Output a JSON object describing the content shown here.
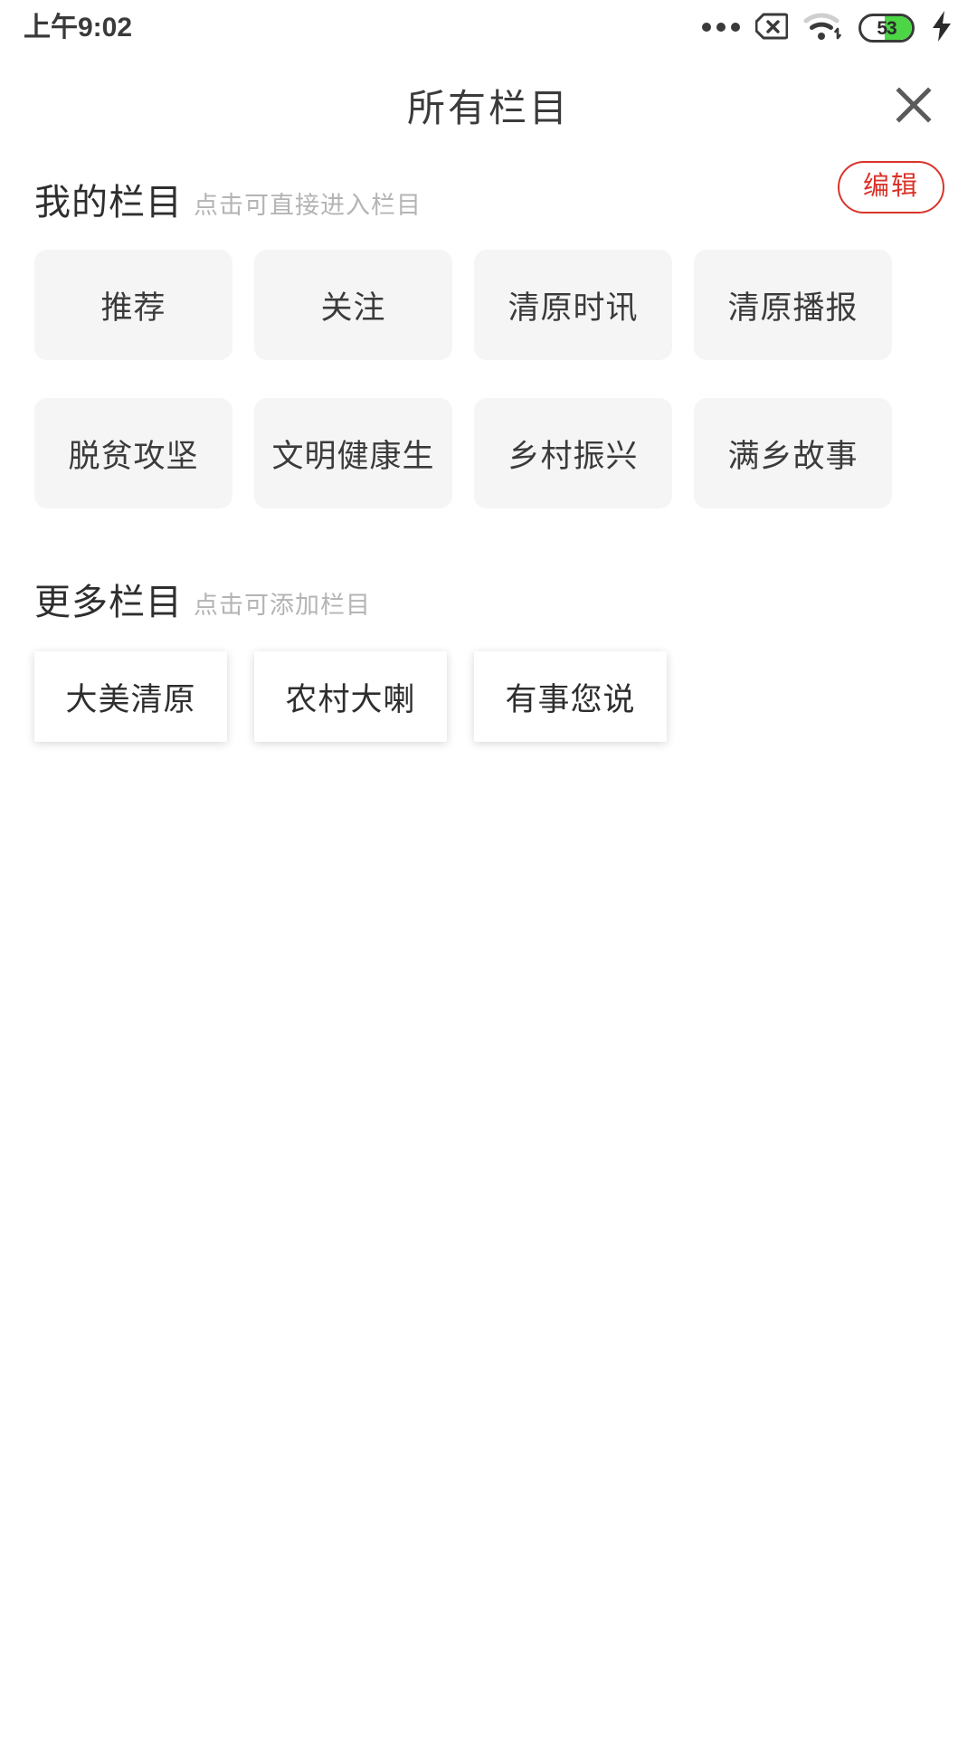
{
  "status_bar": {
    "time": "上午9:02",
    "battery_percent": "53",
    "battery_level": 53,
    "icons": [
      "more-dots-icon",
      "sim-card-disabled-icon",
      "wifi-icon",
      "battery-icon",
      "charging-bolt-icon"
    ]
  },
  "header": {
    "title": "所有栏目",
    "close_label": "×"
  },
  "my_columns": {
    "title": "我的栏目",
    "subtitle": "点击可直接进入栏目",
    "edit_label": "编辑",
    "edit_color": "#d9342b",
    "tile_bg": "#f5f5f5",
    "items": [
      {
        "label": "推荐"
      },
      {
        "label": "关注"
      },
      {
        "label": "清原时讯"
      },
      {
        "label": "清原播报"
      },
      {
        "label": "脱贫攻坚"
      },
      {
        "label": "文明健康生"
      },
      {
        "label": "乡村振兴"
      },
      {
        "label": "满乡故事"
      }
    ]
  },
  "more_columns": {
    "title": "更多栏目",
    "subtitle": "点击可添加栏目",
    "tile_bg": "#ffffff",
    "items": [
      {
        "label": "大美清原"
      },
      {
        "label": "农村大喇"
      },
      {
        "label": "有事您说"
      }
    ]
  }
}
